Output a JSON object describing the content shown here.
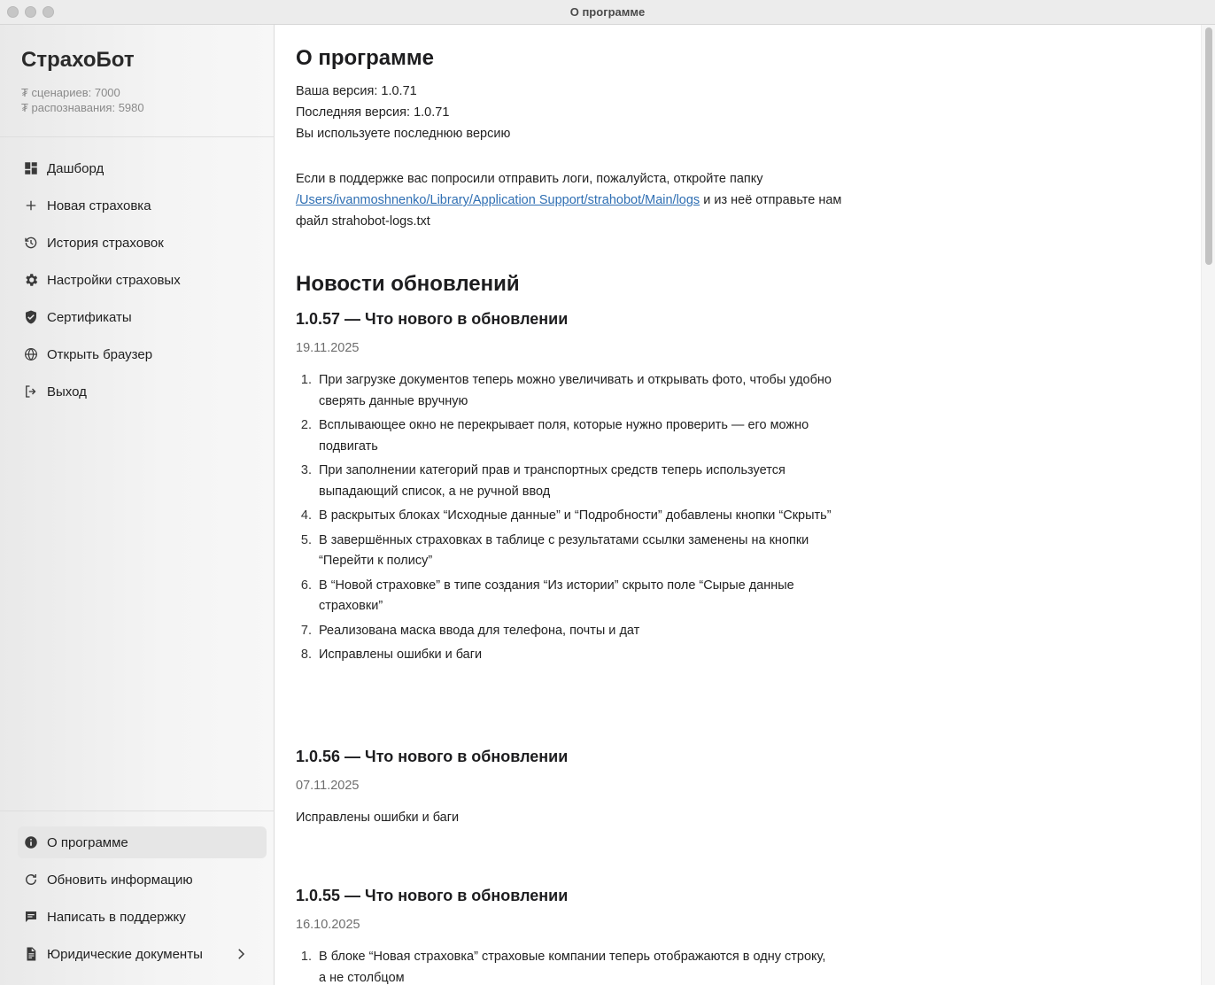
{
  "window": {
    "title": "О программе"
  },
  "sidebar": {
    "brand": "СтрахоБот",
    "stats": [
      "₮ сценариев: 7000",
      "₮ распознавания: 5980"
    ],
    "nav": [
      {
        "label": "Дашборд",
        "icon": "dashboard-icon"
      },
      {
        "label": "Новая страховка",
        "icon": "plus-icon"
      },
      {
        "label": "История страховок",
        "icon": "history-icon"
      },
      {
        "label": "Настройки страховых",
        "icon": "gear-icon"
      },
      {
        "label": "Сертификаты",
        "icon": "shield-check-icon"
      },
      {
        "label": "Открыть браузер",
        "icon": "globe-icon"
      },
      {
        "label": "Выход",
        "icon": "logout-icon"
      }
    ],
    "bottom": [
      {
        "label": "О программе",
        "icon": "info-icon",
        "active": true
      },
      {
        "label": "Обновить информацию",
        "icon": "refresh-icon"
      },
      {
        "label": "Написать в поддержку",
        "icon": "chat-icon"
      },
      {
        "label": "Юридические документы",
        "icon": "document-icon",
        "chevron": "chevron-right-icon"
      }
    ]
  },
  "main": {
    "title": "О программе",
    "current_version": "Ваша версия: 1.0.71",
    "latest_version": "Последняя версия: 1.0.71",
    "status": "Вы используете последнюю версию",
    "logs_before": "Если в поддержке вас попросили отправить логи, пожалуйста, откройте папку ",
    "logs_path": "/Users/ivanmoshnenko/Library/Application Support/strahobot/Main/logs",
    "logs_after": " и из неё отправьте нам файл strahobot-logs.txt",
    "news_title": "Новости обновлений",
    "updates": [
      {
        "title": "1.0.57 — Что нового в обновлении",
        "date": "19.11.2025",
        "items": [
          "При загрузке документов теперь можно увеличивать и открывать фото, чтобы удобно сверять данные вручную",
          "Всплывающее окно не перекрывает поля, которые нужно проверить — его можно подвигать",
          "При заполнении категорий прав и транспортных средств теперь используется выпадающий список, а не ручной ввод",
          "В раскрытых блоках “Исходные данные” и “Подробности” добавлены кнопки “Скрыть”",
          "В завершённых страховках в таблице с результатами ссылки заменены на кнопки “Перейти к полису”",
          "В “Новой страховке” в типе создания “Из истории” скрыто поле “Сырые данные страховки”",
          "Реализована маска ввода для телефона, почты и дат",
          "Исправлены ошибки и баги"
        ]
      },
      {
        "title": "1.0.56 — Что нового в обновлении",
        "date": "07.11.2025",
        "text": "Исправлены ошибки и баги"
      },
      {
        "title": "1.0.55 — Что нового в обновлении",
        "date": "16.10.2025",
        "items": [
          "В блоке “Новая страховка” страховые компании теперь отображаются в одну строку, а не столбцом"
        ]
      }
    ]
  }
}
